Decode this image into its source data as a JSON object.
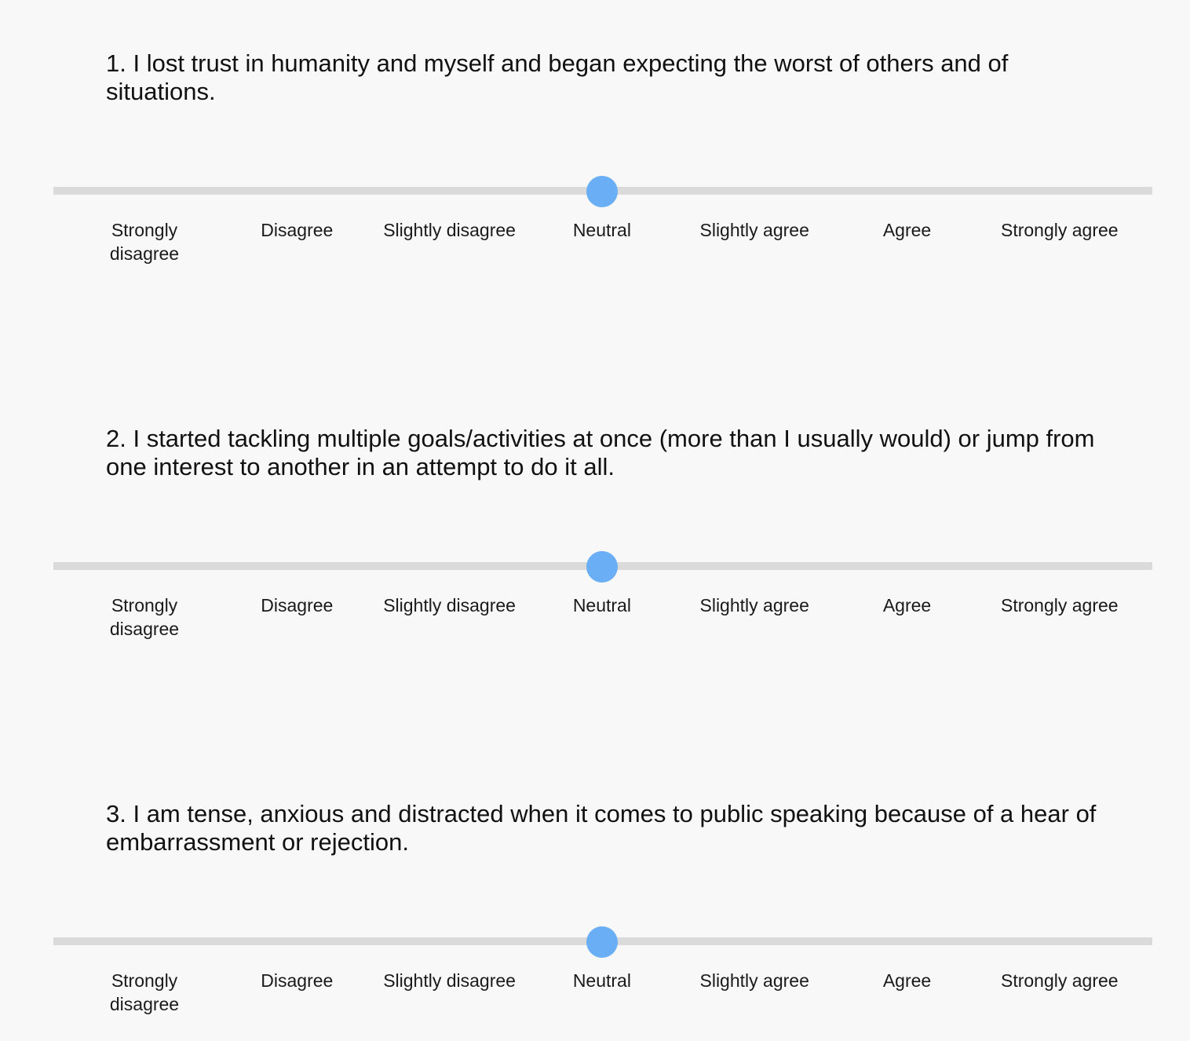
{
  "scale": {
    "options": [
      "Strongly disagree",
      "Disagree",
      "Slightly disagree",
      "Neutral",
      "Slightly agree",
      "Agree",
      "Strongly agree"
    ]
  },
  "questions": [
    {
      "text": "1. I lost trust in humanity and myself and began expecting the worst of others and of situations.",
      "selected_value": "Neutral",
      "selected_index": 3
    },
    {
      "text": "2. I started tackling multiple goals/activities at once (more than I usually would) or jump from one interest to another in an attempt to do it all.",
      "selected_value": "Neutral",
      "selected_index": 3
    },
    {
      "text": "3. I am tense, anxious and distracted when it comes to public speaking because of a hear of embarrassment or rejection.",
      "selected_value": "Neutral",
      "selected_index": 3
    }
  ],
  "colors": {
    "thumb": "#6aaff5",
    "track": "#dadada",
    "background": "#f8f8f8"
  }
}
